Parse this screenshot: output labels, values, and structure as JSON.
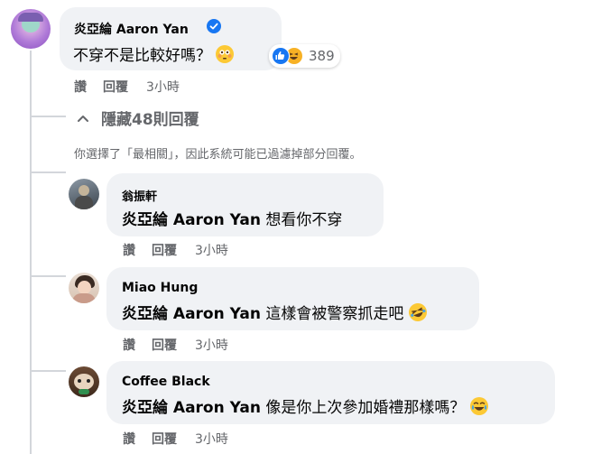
{
  "main_comment": {
    "author": "炎亞綸 Aaron Yan",
    "text": "不穿不是比較好嗎？",
    "reaction_count": "389",
    "actions": {
      "like": "讚",
      "reply": "回覆",
      "time": "3小時"
    }
  },
  "replies_toggle": {
    "label": "隱藏48則回覆"
  },
  "filter_notice": "你選擇了「最相關」，因此系統可能已過濾掉部分回覆。",
  "replies": [
    {
      "author": "翁振軒",
      "mention": "炎亞綸 Aaron Yan",
      "text": " 想看你不穿",
      "like": "讚",
      "reply": "回覆",
      "time": "3小時"
    },
    {
      "author": "Miao Hung",
      "mention": "炎亞綸 Aaron Yan",
      "text": " 這樣會被警察抓走吧",
      "like": "讚",
      "reply": "回覆",
      "time": "3小時"
    },
    {
      "author": "Coffee Black",
      "mention": "炎亞綸 Aaron Yan",
      "text": " 像是你上次參加婚禮那樣嗎？",
      "like": "讚",
      "reply": "回覆",
      "time": "3小時"
    }
  ],
  "colors": {
    "bubble": "#f0f2f5",
    "secondary_text": "#65676b",
    "verified": "#1877f2"
  }
}
